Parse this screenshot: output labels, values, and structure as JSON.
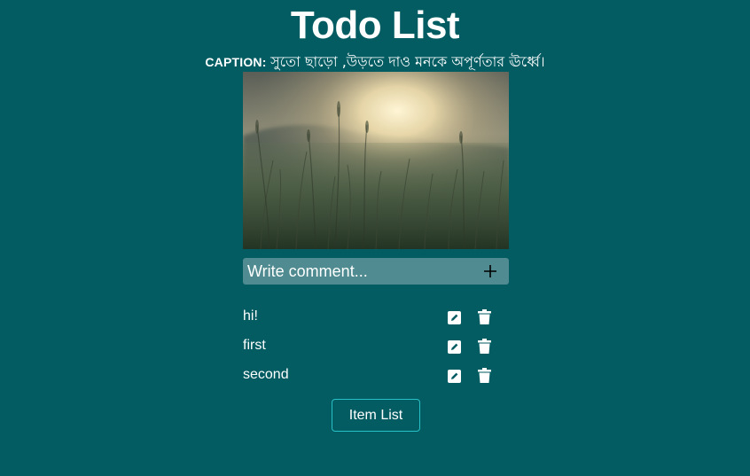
{
  "header": {
    "title": "Todo List"
  },
  "caption": {
    "label": "CAPTION:",
    "text": "সুতো ছাড়ো ,উড়তে দাও মনকে অপূর্ণতার ঊর্ধ্বে।"
  },
  "photo": {
    "subject": "sunset-over-grass-field"
  },
  "comment": {
    "placeholder": "Write comment...",
    "value": "",
    "add_icon": "plus-icon"
  },
  "todos": [
    {
      "text": "hi!",
      "edit_icon": "edit-icon",
      "delete_icon": "trash-icon"
    },
    {
      "text": "first",
      "edit_icon": "edit-icon",
      "delete_icon": "trash-icon"
    },
    {
      "text": "second",
      "edit_icon": "edit-icon",
      "delete_icon": "trash-icon"
    }
  ],
  "footer": {
    "item_list_label": "Item List"
  },
  "colors": {
    "background": "#025c62",
    "input_background": "#4f8b90",
    "button_border": "#27c0c6",
    "text": "#ffffff"
  }
}
